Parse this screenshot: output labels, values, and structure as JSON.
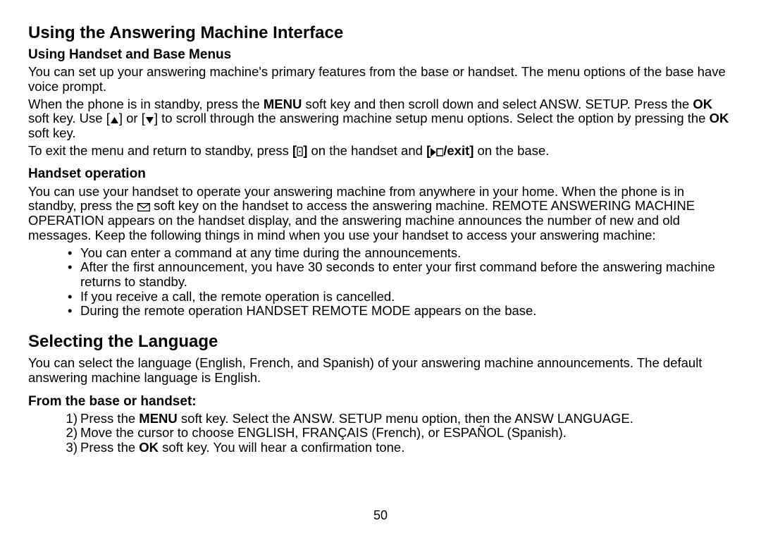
{
  "heading1": "Using the Answering Machine Interface",
  "s1": {
    "heading": "Using Handset and Base Menus",
    "p1": "You can set up your answering machine's primary features from the base or handset. The menu options of the base have voice prompt.",
    "p2_a": "When the phone is in standby, press the ",
    "p2_menu": "MENU",
    "p2_b": " soft key and then scroll down and select ANSW. SETUP. Press the ",
    "p2_ok1": "OK",
    "p2_c": " soft key. Use [",
    "p2_d": "] or [",
    "p2_e": "] to scroll through the answering machine setup menu options. Select the option by pressing the ",
    "p2_ok2": "OK",
    "p2_f": " soft key.",
    "p3_a": "To exit the menu and return to standby, press ",
    "p3_b": " on the handset and ",
    "p3_c": "[",
    "p3_exit": "/exit]",
    "p3_d": " on the base."
  },
  "s2": {
    "heading": "Handset operation",
    "p1_a": "You can use your handset to operate your answering machine from anywhere in your home. When the phone is in standby, press the ",
    "p1_b": " soft key on the handset to access the answering machine. REMOTE ANSWERING MACHINE OPERATION appears on the handset display, and the answering machine announces the number of new and old messages. Keep the following things in mind when you use your handset to access your answering machine:",
    "li1": "You can enter a command at any time during the announcements.",
    "li2": "After the first announcement, you have 30 seconds to enter your first command before the answering machine returns to standby.",
    "li3": "If you receive a call, the remote operation is cancelled.",
    "li4": "During the remote operation HANDSET REMOTE MODE appears on the base."
  },
  "heading2": "Selecting the Language",
  "s3": {
    "p1": "You can select the language (English, French, and Spanish) of your answering machine announcements. The default answering machine language is English."
  },
  "s4": {
    "heading": "From the base or handset:",
    "li1_a": "Press the ",
    "li1_menu": "MENU",
    "li1_b": " soft key. Select the ANSW. SETUP menu option, then the ANSW LANGUAGE.",
    "li2": "Move the cursor to choose ENGLISH, FRANÇAIS (French), or ESPAÑOL (Spanish).",
    "li3_a": "Press the ",
    "li3_ok": "OK",
    "li3_b": " soft key. You will hear a confirmation tone."
  },
  "page": "50"
}
